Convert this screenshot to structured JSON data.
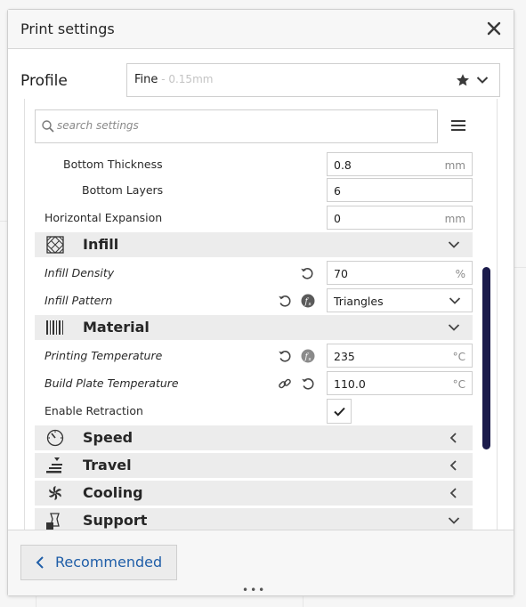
{
  "window": {
    "title": "Print settings"
  },
  "profile": {
    "label": "Profile",
    "name": "Fine",
    "sub": " - 0.15mm"
  },
  "search": {
    "placeholder": "search settings"
  },
  "settings": {
    "bottom_thickness": {
      "label": "Bottom Thickness",
      "value": "0.8",
      "unit": "mm"
    },
    "bottom_layers": {
      "label": "Bottom Layers",
      "value": "6"
    },
    "horizontal_expansion": {
      "label": "Horizontal Expansion",
      "value": "0",
      "unit": "mm"
    },
    "infill_density": {
      "label": "Infill Density",
      "value": "70",
      "unit": "%"
    },
    "infill_pattern": {
      "label": "Infill Pattern",
      "value": "Triangles"
    },
    "printing_temperature": {
      "label": "Printing Temperature",
      "value": "235",
      "unit": "°C"
    },
    "build_plate_temperature": {
      "label": "Build Plate Temperature",
      "value": "110.0",
      "unit": "°C"
    },
    "enable_retraction": {
      "label": "Enable Retraction",
      "checked": true
    }
  },
  "categories": {
    "infill": {
      "label": "Infill",
      "expanded": true
    },
    "material": {
      "label": "Material",
      "expanded": true
    },
    "speed": {
      "label": "Speed",
      "expanded": false
    },
    "travel": {
      "label": "Travel",
      "expanded": false
    },
    "cooling": {
      "label": "Cooling",
      "expanded": false
    },
    "support": {
      "label": "Support",
      "expanded": true
    }
  },
  "footer": {
    "recommended_label": "Recommended"
  },
  "colors": {
    "accent": "#1f5ea8",
    "scrollbar": "#1b1b4b",
    "category_bg": "#ececec"
  },
  "icons": [
    "close-icon",
    "star-icon",
    "chevron-down-icon",
    "search-icon",
    "menu-icon",
    "reset-icon",
    "function-icon",
    "link-icon",
    "checkmark-icon",
    "infill-icon",
    "material-icon",
    "speed-icon",
    "travel-icon",
    "cooling-icon",
    "support-icon",
    "chevron-left-icon"
  ]
}
